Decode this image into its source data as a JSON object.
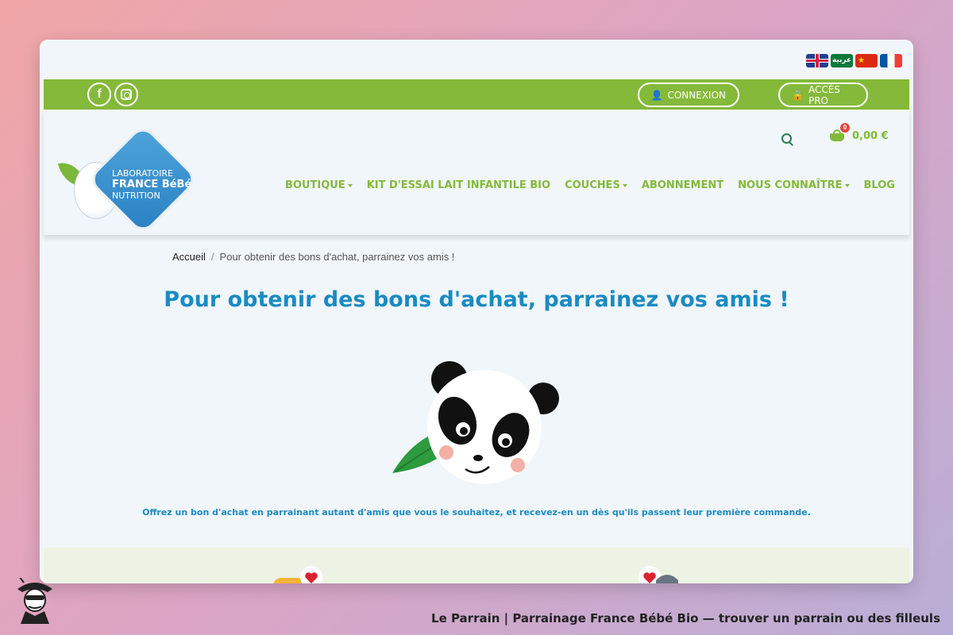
{
  "languages": [
    {
      "code": "en",
      "icon": "uk-flag-icon"
    },
    {
      "code": "ar",
      "icon": "arabic-flag-icon",
      "label": "عربية"
    },
    {
      "code": "zh",
      "icon": "china-flag-icon"
    },
    {
      "code": "fr",
      "icon": "france-flag-icon"
    }
  ],
  "topbar": {
    "social": [
      {
        "name": "facebook",
        "glyph": "f"
      },
      {
        "name": "instagram"
      }
    ],
    "login_label": "CONNEXION",
    "pro_label": "ACCÈS PRO"
  },
  "logo": {
    "line1": "LABORATOIRE",
    "line2": "FRANCE BéBé",
    "line3": "NUTRITION"
  },
  "cart": {
    "count": "0",
    "total": "0,00 €"
  },
  "nav": {
    "items": [
      {
        "label": "BOUTIQUE",
        "dropdown": true
      },
      {
        "label": "KIT D'ESSAI LAIT INFANTILE BIO",
        "dropdown": false
      },
      {
        "label": "COUCHES",
        "dropdown": true
      },
      {
        "label": "ABONNEMENT",
        "dropdown": false
      },
      {
        "label": "NOUS CONNAÎTRE",
        "dropdown": true
      },
      {
        "label": "BLOG",
        "dropdown": false
      }
    ]
  },
  "breadcrumb": {
    "home": "Accueil",
    "separator": "/",
    "current": "Pour obtenir des bons d'achat, parrainez vos amis !"
  },
  "page": {
    "title": "Pour obtenir des bons d'achat, parrainez vos amis !",
    "intro": "Offrez un bon d'achat en parrainant autant d'amis que vous le souhaitez, et recevez-en un dès qu'ils passent leur première commande."
  },
  "footer": {
    "caption": "Le Parrain | Parrainage France Bébé Bio — trouver un parrain ou des filleuls"
  },
  "colors": {
    "brand_green": "#84b93a",
    "title_blue": "#1a8bc2",
    "page_bg": "#f1f6fb"
  }
}
